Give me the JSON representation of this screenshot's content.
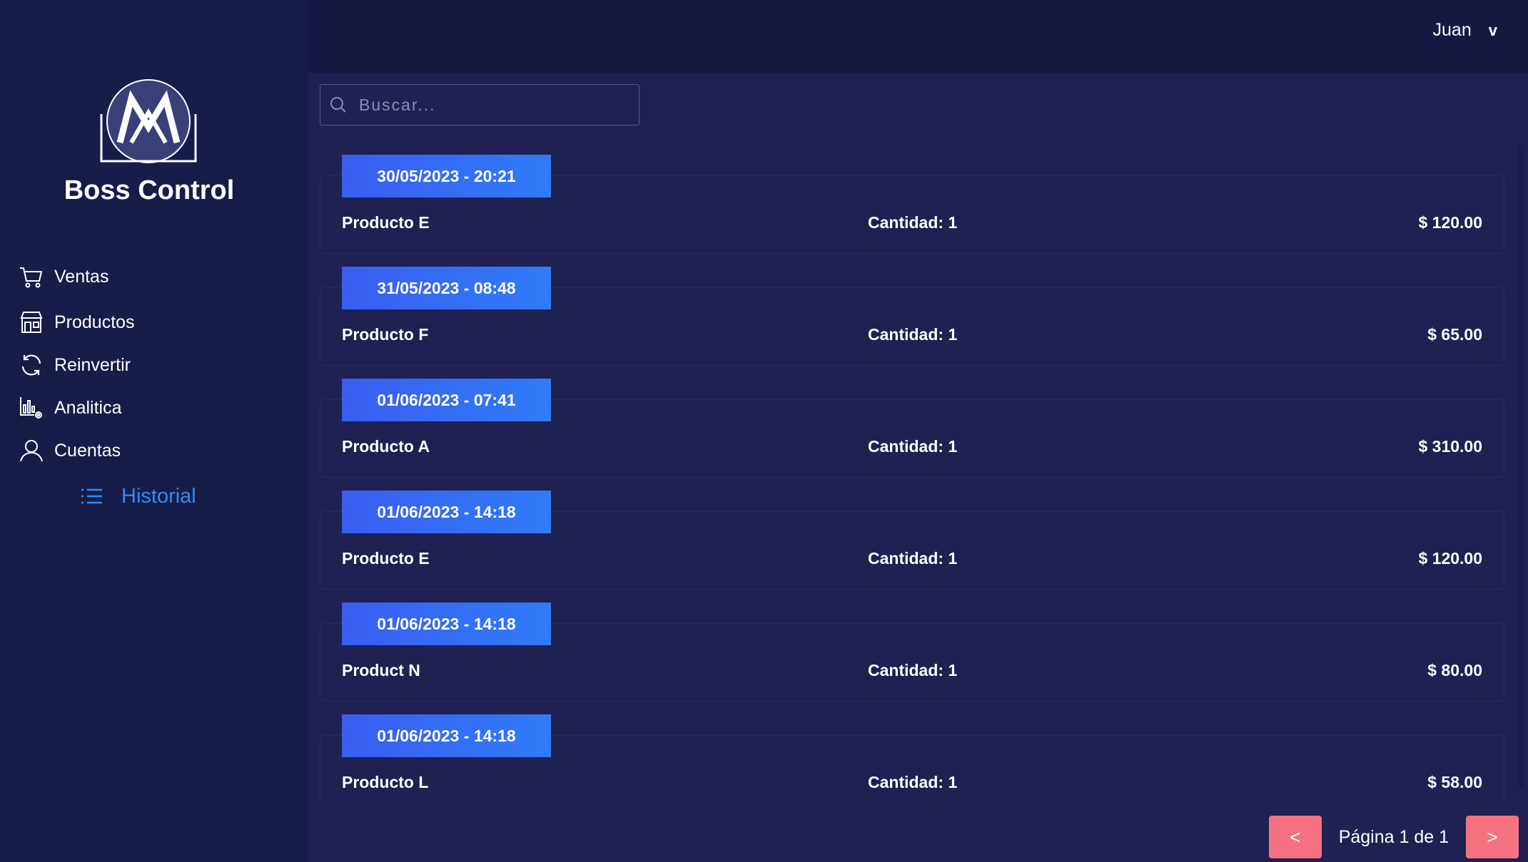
{
  "header": {
    "user_name": "Juan",
    "user_menu_chevron": "v"
  },
  "sidebar": {
    "brand": "Boss Control",
    "items": [
      {
        "label": "Ventas",
        "icon": "cart-icon"
      },
      {
        "label": "Productos",
        "icon": "store-icon"
      },
      {
        "label": "Reinvertir",
        "icon": "refresh-icon"
      },
      {
        "label": "Analitica",
        "icon": "analytics-icon"
      },
      {
        "label": "Cuentas",
        "icon": "user-icon"
      },
      {
        "label": "Historial",
        "icon": "list-icon",
        "active": true
      }
    ]
  },
  "search": {
    "placeholder": "Buscar..."
  },
  "history": [
    {
      "date": "30/05/2023 - 20:21",
      "product": "Producto E",
      "quantity": "Cantidad: 1",
      "price": "$ 120.00"
    },
    {
      "date": "31/05/2023 - 08:48",
      "product": "Producto F",
      "quantity": "Cantidad: 1",
      "price": "$ 65.00"
    },
    {
      "date": "01/06/2023 - 07:41",
      "product": "Producto A",
      "quantity": "Cantidad: 1",
      "price": "$ 310.00"
    },
    {
      "date": "01/06/2023 - 14:18",
      "product": "Producto E",
      "quantity": "Cantidad: 1",
      "price": "$ 120.00"
    },
    {
      "date": "01/06/2023 - 14:18",
      "product": "Product N",
      "quantity": "Cantidad: 1",
      "price": "$ 80.00"
    },
    {
      "date": "01/06/2023 - 14:18",
      "product": "Producto L",
      "quantity": "Cantidad: 1",
      "price": "$ 58.00"
    }
  ],
  "pagination": {
    "prev": "<",
    "next": ">",
    "label": "Página 1 de 1"
  },
  "colors": {
    "accent": "#2f8cf7",
    "date_badge": "#3a6ff5",
    "pager_button": "#f4727f",
    "background": "#1f2152"
  }
}
